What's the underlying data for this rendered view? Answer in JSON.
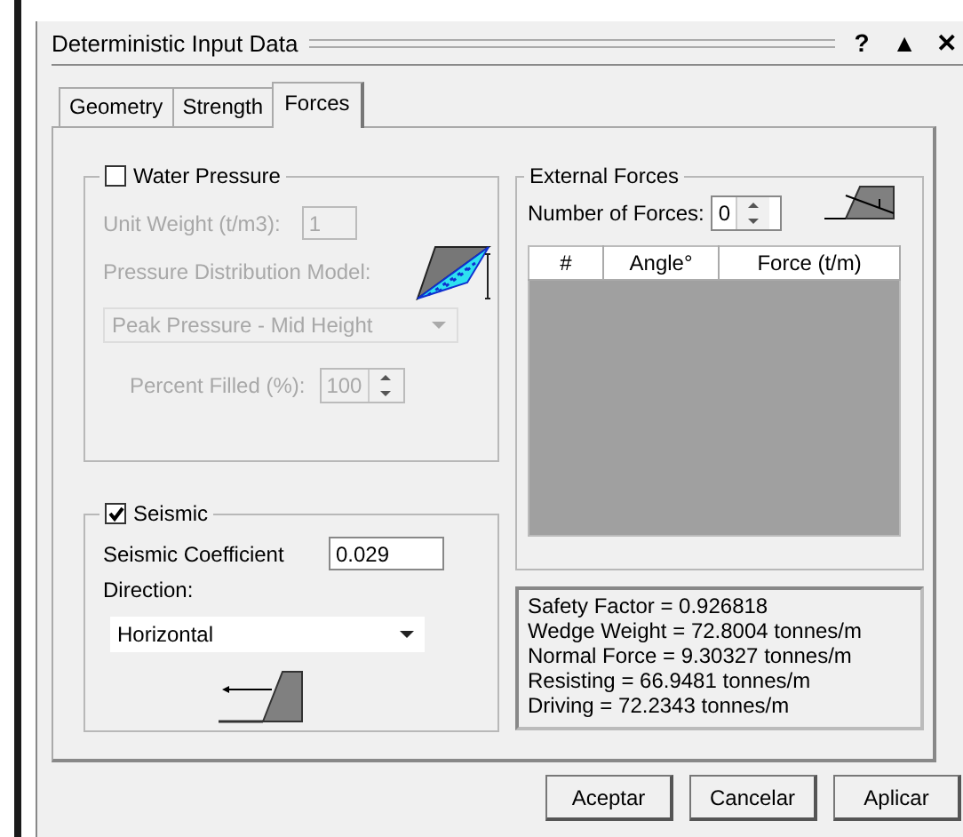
{
  "window": {
    "title": "Deterministic Input Data",
    "controls": [
      "?",
      "▲",
      "✕"
    ]
  },
  "tabs": [
    {
      "label": "Geometry",
      "selected": false
    },
    {
      "label": "Strength",
      "selected": false
    },
    {
      "label": "Forces",
      "selected": true
    }
  ],
  "water_pressure": {
    "label": "Water Pressure",
    "checked": false,
    "disabled": true,
    "unit_weight": {
      "label": "Unit Weight (t/m3):",
      "value": "1"
    },
    "distribution": {
      "label": "Pressure Distribution Model:",
      "value": "Peak Pressure - Mid Height"
    },
    "percent_filled": {
      "label": "Percent Filled (%):",
      "value": "100"
    }
  },
  "seismic": {
    "label": "Seismic",
    "checked": true,
    "disabled": false,
    "coefficient": {
      "label": "Seismic Coefficient",
      "value": "0.029"
    },
    "direction": {
      "label": "Direction:",
      "value": "Horizontal"
    }
  },
  "external_forces": {
    "title": "External Forces",
    "count": {
      "label": "Number of Forces:",
      "value": "0"
    },
    "table": {
      "columns": [
        "#",
        "Angle°",
        "Force (t/m)"
      ]
    }
  },
  "results": [
    "Safety Factor = 0.926818",
    "Wedge Weight = 72.8004 tonnes/m",
    "Normal Force = 9.30327 tonnes/m",
    "Resisting = 66.9481 tonnes/m",
    "Driving = 72.2343 tonnes/m"
  ],
  "buttons": [
    "Aceptar",
    "Cancelar",
    "Aplicar"
  ]
}
